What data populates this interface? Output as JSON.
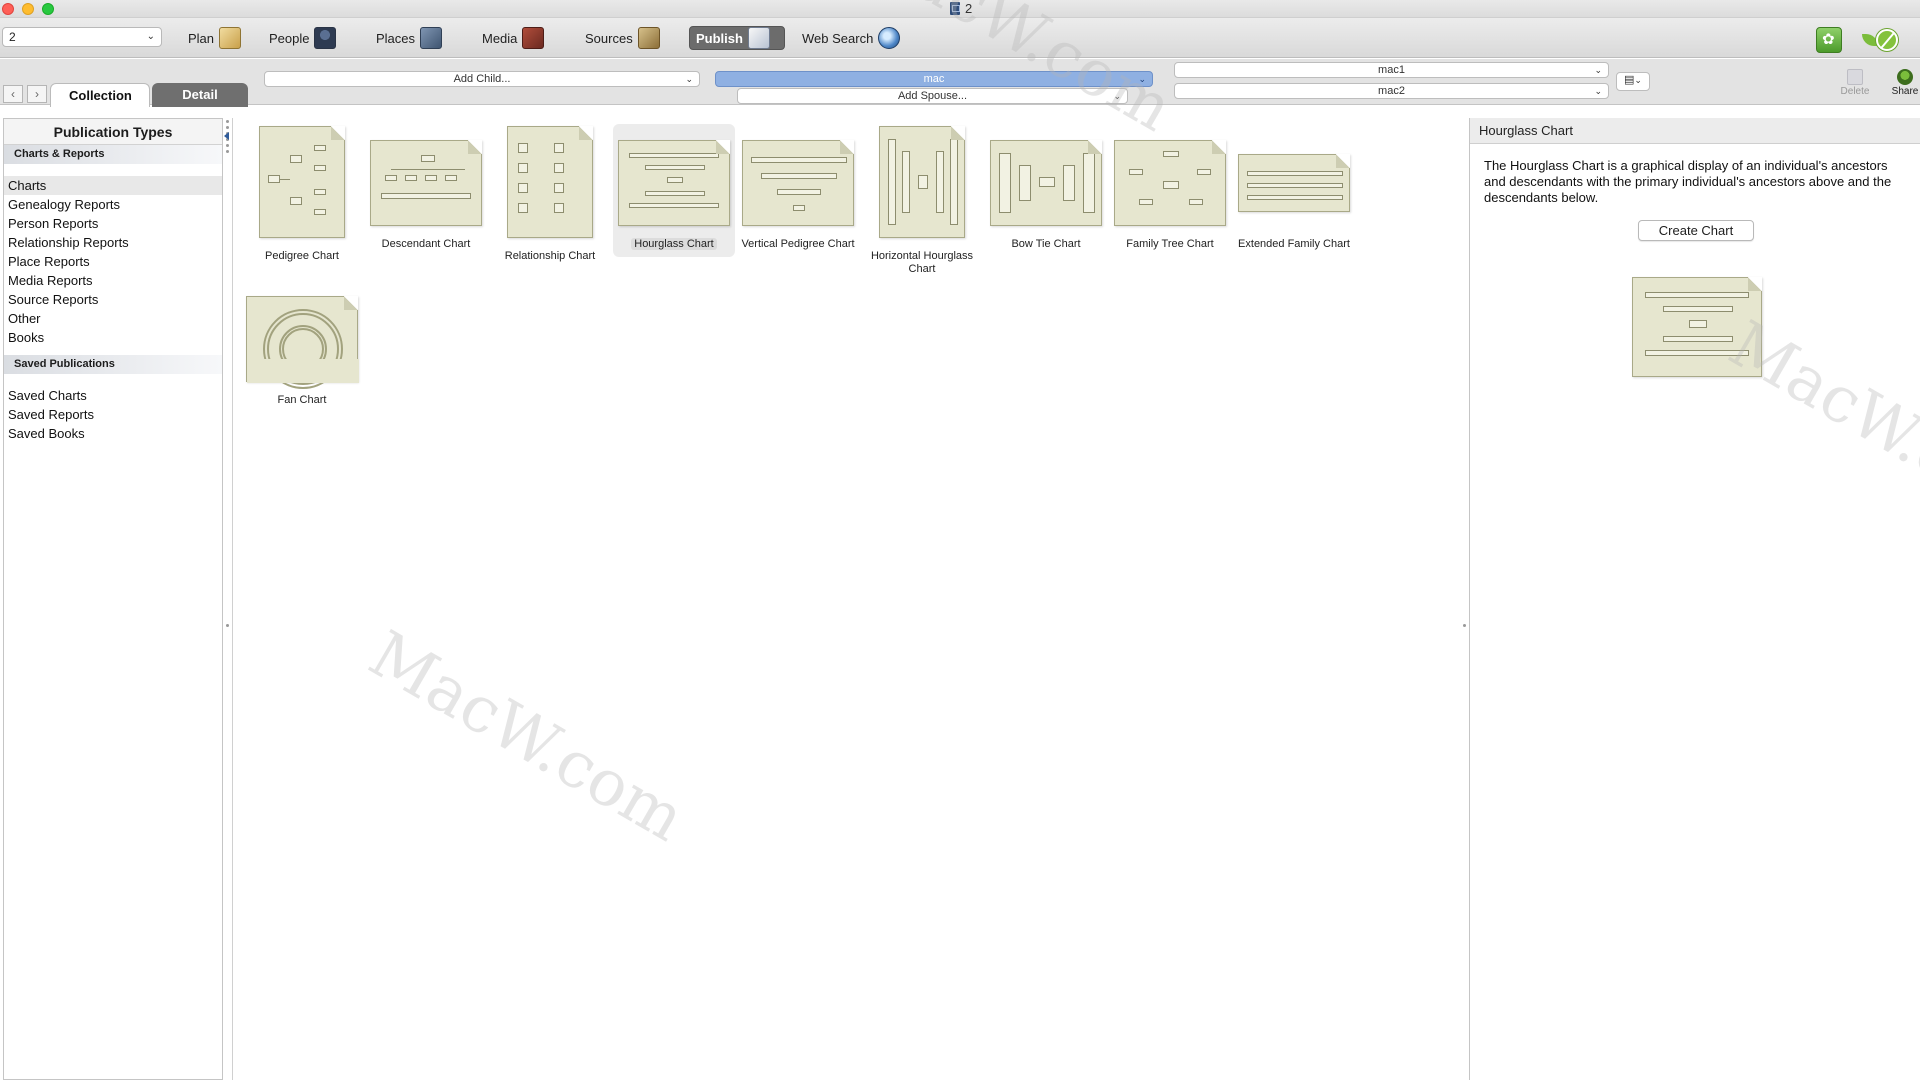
{
  "window": {
    "title": "2"
  },
  "toolbar": {
    "tree_select": "2",
    "buttons": [
      {
        "label": "Plan",
        "icon": "plan-icon"
      },
      {
        "label": "People",
        "icon": "people-icon"
      },
      {
        "label": "Places",
        "icon": "places-icon"
      },
      {
        "label": "Media",
        "icon": "media-icon"
      },
      {
        "label": "Sources",
        "icon": "sources-icon"
      },
      {
        "label": "Publish",
        "icon": "publish-icon",
        "active": true
      },
      {
        "label": "Web Search",
        "icon": "web-search-icon"
      }
    ]
  },
  "subbar": {
    "tabs": [
      {
        "label": "Collection",
        "active": true
      },
      {
        "label": "Detail",
        "active": false
      }
    ],
    "add_child": "Add Child...",
    "person": "mac",
    "add_spouse": "Add Spouse...",
    "father": "mac1",
    "mother": "mac2",
    "delete_label": "Delete",
    "share_label": "Share"
  },
  "sidebar": {
    "title": "Publication Types",
    "groups": [
      {
        "label": "Charts & Reports",
        "items": [
          "Charts",
          "Genealogy Reports",
          "Person Reports",
          "Relationship Reports",
          "Place Reports",
          "Media Reports",
          "Source Reports",
          "Other",
          "Books"
        ],
        "selected": 0
      },
      {
        "label": "Saved Publications",
        "items": [
          "Saved Charts",
          "Saved Reports",
          "Saved Books"
        ]
      }
    ]
  },
  "charts": [
    {
      "label": "Pedigree Chart"
    },
    {
      "label": "Descendant Chart"
    },
    {
      "label": "Relationship Chart"
    },
    {
      "label": "Hourglass Chart",
      "selected": true
    },
    {
      "label": "Vertical Pedigree Chart"
    },
    {
      "label": "Horizontal Hourglass Chart"
    },
    {
      "label": "Bow Tie Chart"
    },
    {
      "label": "Family Tree Chart"
    },
    {
      "label": "Extended Family Chart"
    },
    {
      "label": "Fan Chart"
    }
  ],
  "detail": {
    "title": "Hourglass Chart",
    "description": "The Hourglass Chart is a graphical display of an individual's ancestors and descendants with the primary individual's ancestors above and the descendants below.",
    "create_button": "Create Chart"
  },
  "watermark": "MacW.com",
  "colors": {
    "accent_blue": "#8fb0e2",
    "active_tab": "#6c6c6c",
    "thumb_paper": "#e6e6cf"
  }
}
